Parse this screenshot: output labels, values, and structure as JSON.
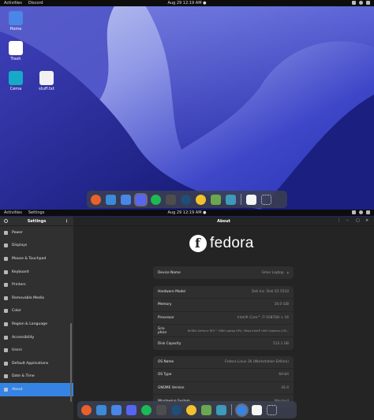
{
  "top_screen": {
    "topbar": {
      "activities": "Activities",
      "app_name": "Discord",
      "clock": "Aug 29  12:19 AM  ●"
    },
    "desktop_icons": [
      {
        "label": "Home",
        "color": "#4a86e8"
      },
      {
        "label": "Trash",
        "color": "#ffffff"
      },
      {
        "label": "Cema",
        "color": "#17a9c8"
      },
      {
        "label": "stuff.txt",
        "color": "#f1f1f1"
      }
    ]
  },
  "bottom_screen": {
    "topbar": {
      "activities": "Activities",
      "app_name": "Settings",
      "clock": "Aug 29  12:19 AM  ●"
    },
    "sidebar": {
      "title": "Settings",
      "items": [
        {
          "label": "Power"
        },
        {
          "label": "Displays"
        },
        {
          "label": "Mouse & Touchpad"
        },
        {
          "label": "Keyboard"
        },
        {
          "label": "Printers"
        },
        {
          "label": "Removable Media"
        },
        {
          "label": "Color"
        },
        {
          "label": "Region & Language"
        },
        {
          "label": "Accessibility"
        },
        {
          "label": "Users"
        },
        {
          "label": "Default Applications"
        },
        {
          "label": "Date & Time"
        },
        {
          "label": "About",
          "selected": true
        }
      ]
    },
    "main": {
      "title": "About",
      "logo_text": "fedora",
      "device": {
        "label": "Device Name",
        "value": "Emer Laptop"
      },
      "hardware": [
        {
          "label": "Hardware Model",
          "value": "Dell Inc. Dell G5 5510"
        },
        {
          "label": "Memory",
          "value": "16.0 GiB"
        },
        {
          "label": "Processor",
          "value": "Intel® Core™ i7-10870H × 16"
        },
        {
          "label": "Gra-\nphics",
          "value": "NVIDIA GeForce RTX™ 3060 Laptop GPU / Mesa Intel® UHD Graphics (CM..."
        },
        {
          "label": "Disk Capacity",
          "value": "512.1 GB"
        }
      ],
      "software": [
        {
          "label": "OS Name",
          "value": "Fedora Linux 36 (Workstation Edition)"
        },
        {
          "label": "OS Type",
          "value": "64-bit"
        },
        {
          "label": "GNOME Version",
          "value": "42.4"
        },
        {
          "label": "Windowing System",
          "value": "Wayland"
        }
      ]
    }
  },
  "dock_apps": [
    {
      "name": "firefox",
      "color": "#e8612c"
    },
    {
      "name": "files",
      "color": "#3c8bd8"
    },
    {
      "name": "mail",
      "color": "#4a86e8"
    },
    {
      "name": "discord",
      "color": "#5865f2"
    },
    {
      "name": "spotify",
      "color": "#1db954"
    },
    {
      "name": "terminal",
      "color": "#4d4d4d"
    },
    {
      "name": "steam",
      "color": "#1f4e79"
    },
    {
      "name": "photos",
      "color": "#f2c12e"
    },
    {
      "name": "minecraft",
      "color": "#6aa84f"
    },
    {
      "name": "settings",
      "color": "#3d9ab8"
    }
  ],
  "dock_extra": [
    {
      "name": "recycle",
      "color": "#f5f5f5"
    },
    {
      "name": "app-grid",
      "color": "#dddddd"
    }
  ],
  "colors": {
    "accent": "#3584e4",
    "panel": "#242424",
    "sidebar": "#303030"
  }
}
